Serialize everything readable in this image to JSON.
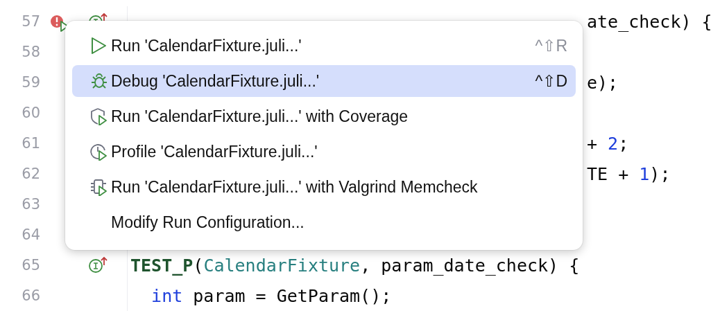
{
  "editor": {
    "lines": [
      {
        "number": "57",
        "gutter": [
          {
            "kind": "error"
          },
          {
            "kind": "run"
          },
          {
            "kind": "test"
          }
        ],
        "tail": [
          {
            "kind": "plain",
            "text": "ate_check) {"
          }
        ]
      },
      {
        "number": "58"
      },
      {
        "number": "59",
        "tail": [
          {
            "kind": "plain",
            "text": "e);"
          }
        ]
      },
      {
        "number": "60"
      },
      {
        "number": "61",
        "tail": [
          {
            "kind": "plain",
            "text": "+ "
          },
          {
            "kind": "number",
            "text": "2"
          },
          {
            "kind": "plain",
            "text": ";"
          }
        ]
      },
      {
        "number": "62",
        "tail": [
          {
            "kind": "plain",
            "text": "TE + "
          },
          {
            "kind": "number",
            "text": "1"
          },
          {
            "kind": "plain",
            "text": ");"
          }
        ]
      },
      {
        "number": "63"
      },
      {
        "number": "64"
      },
      {
        "number": "65",
        "gutter": [
          {
            "kind": "test"
          }
        ],
        "tokens": [
          {
            "kind": "keyword",
            "text": "TEST_P"
          },
          {
            "kind": "plain",
            "text": "("
          },
          {
            "kind": "class",
            "text": "CalendarFixture"
          },
          {
            "kind": "plain",
            "text": ", param_date_check) {"
          }
        ]
      },
      {
        "number": "66",
        "indented": true,
        "tokens": [
          {
            "kind": "type",
            "text": "int"
          },
          {
            "kind": "plain",
            "text": " param = GetParam();"
          }
        ]
      }
    ]
  },
  "menu": {
    "items": [
      {
        "kind": "run",
        "label": "Run 'CalendarFixture.juli...'",
        "shortcut": "^⇧R",
        "selected": false
      },
      {
        "kind": "debug",
        "label": "Debug 'CalendarFixture.juli...'",
        "shortcut": "^⇧D",
        "selected": true
      },
      {
        "kind": "coverage",
        "label": "Run 'CalendarFixture.juli...' with Coverage",
        "selected": false
      },
      {
        "kind": "profile",
        "label": "Profile 'CalendarFixture.juli...'",
        "selected": false
      },
      {
        "kind": "valgrind",
        "label": "Run 'CalendarFixture.juli...' with Valgrind Memcheck",
        "selected": false
      },
      {
        "kind": "none",
        "label": "Modify Run Configuration...",
        "selected": false
      }
    ]
  }
}
